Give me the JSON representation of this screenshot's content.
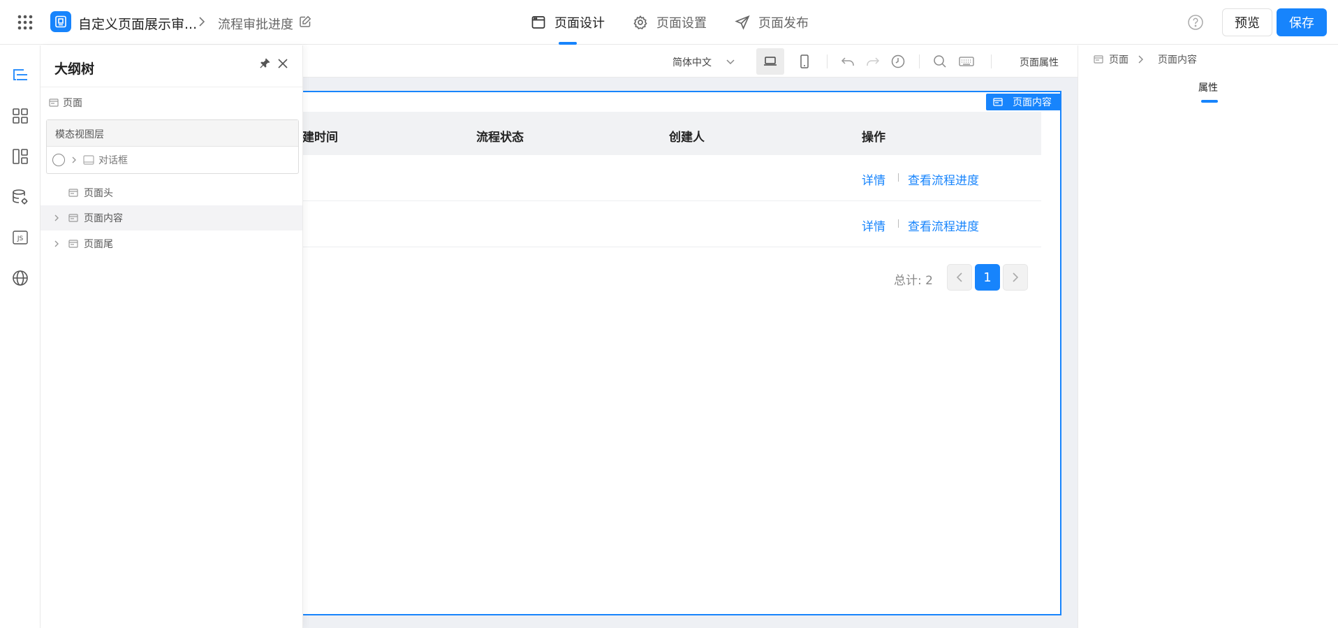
{
  "header": {
    "app_name": "自定义页面展示审...",
    "page_title": "流程审批进度",
    "tabs": [
      {
        "label": "页面设计",
        "icon": "browser-window-icon",
        "active": true
      },
      {
        "label": "页面设置",
        "icon": "gear-icon",
        "active": false
      },
      {
        "label": "页面发布",
        "icon": "send-icon",
        "active": false
      }
    ],
    "preview_label": "预览",
    "save_label": "保存"
  },
  "rail": {
    "icons": [
      "outline-tree-icon",
      "components-grid-icon",
      "layout-icon",
      "datasource-icon",
      "js-code-icon",
      "globe-icon"
    ]
  },
  "outline": {
    "title": "大纲树",
    "root_label": "页面",
    "modal_layer_title": "模态视图层",
    "modal_item_label": "对话框",
    "items": [
      {
        "label": "页面头",
        "expandable": false,
        "selected": false
      },
      {
        "label": "页面内容",
        "expandable": true,
        "selected": true
      },
      {
        "label": "页面尾",
        "expandable": true,
        "selected": false
      }
    ]
  },
  "toolbar": {
    "language": "简体中文",
    "page_props_label": "页面属性"
  },
  "canvas": {
    "badge_label": "页面内容",
    "columns": [
      "建时间",
      "流程状态",
      "创建人",
      "操作"
    ],
    "rows": [
      {
        "detail": "详情",
        "progress": "查看流程进度"
      },
      {
        "detail": "详情",
        "progress": "查看流程进度"
      }
    ],
    "total_label": "总计: 2",
    "current_page": "1"
  },
  "right_panel": {
    "breadcrumb": [
      "页面",
      "页面内容"
    ],
    "tab_label": "属性"
  },
  "colors": {
    "accent": "#1784fc",
    "canvas_bg": "#eef0f4",
    "table_head_bg": "#f1f2f4"
  }
}
